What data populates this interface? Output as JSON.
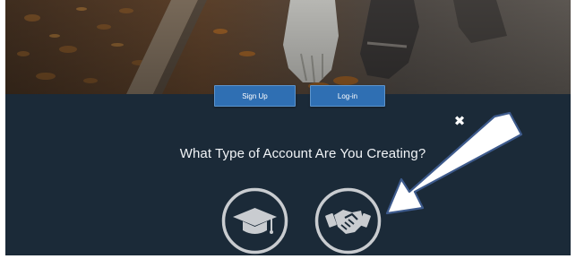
{
  "auth": {
    "signup_label": "Sign Up",
    "login_label": "Log-in"
  },
  "modal": {
    "close_symbol": "✖",
    "question": "What Type of Account Are You Creating?",
    "options": [
      {
        "icon": "graduation-cap-icon"
      },
      {
        "icon": "handshake-icon"
      }
    ]
  },
  "colors": {
    "panel_bg": "#1b2a38",
    "button_blue": "#2f6fb3",
    "icon_ring": "#c9ccd0",
    "arrow_fill": "#ffffff",
    "arrow_stroke": "#3d5a8c"
  }
}
